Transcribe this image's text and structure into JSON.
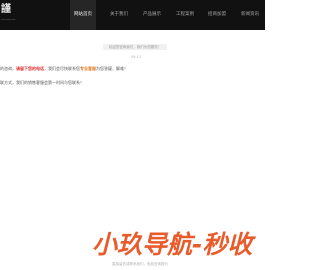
{
  "header": {
    "logo_glyph": "謹",
    "logo_sub": "一·一·一",
    "nav": [
      {
        "label": "网站首页",
        "active": true
      },
      {
        "label": "关于我们",
        "active": false
      },
      {
        "label": "产品展示",
        "active": false
      },
      {
        "label": "工程案例",
        "active": false
      },
      {
        "label": "招商加盟",
        "active": false
      },
      {
        "label": "新闻资讯",
        "active": false
      }
    ]
  },
  "chat": {
    "notice": "欢迎您咨询我们，我们为您服务！",
    "time": "09:13",
    "message1": {
      "prefix": "的咨询，",
      "red": "请留下您的电话",
      "middle": "，我们会尽快联系您",
      "orange": "专业客服",
      "suffix": "为您答疑、解难！"
    },
    "message2": "联方式，我们的销售客服会第一时间与您联系！"
  },
  "brand": {
    "text": "小玖导航-秒收"
  },
  "footer": {
    "text": "直接留言或联系我们，免费咨询报价"
  }
}
